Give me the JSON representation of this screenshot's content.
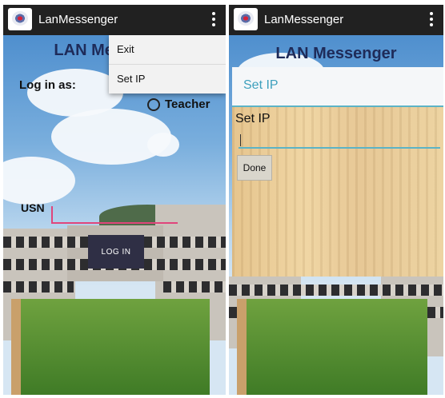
{
  "left_screen": {
    "app_title": "LanMessenger",
    "header_title": "LAN Messenger",
    "login_as_label": "Log in as:",
    "teacher_option": "Teacher",
    "usn_label": "USN",
    "login_button": "LOG IN",
    "menu": [
      {
        "label": "Exit"
      },
      {
        "label": "Set IP"
      }
    ]
  },
  "right_screen": {
    "app_title": "LanMessenger",
    "header_title": "LAN Messenger",
    "dialog": {
      "title": "Set IP",
      "field_label": "Set IP",
      "input_value": "",
      "done_button": "Done"
    }
  },
  "colors": {
    "action_bar": "#212121",
    "accent": "#3ea0bd",
    "login_button": "#2f2f45",
    "field_underline": "#e0457b"
  },
  "icons": [
    "app-logo-icon",
    "overflow-menu-icon",
    "radio-button-icon"
  ]
}
